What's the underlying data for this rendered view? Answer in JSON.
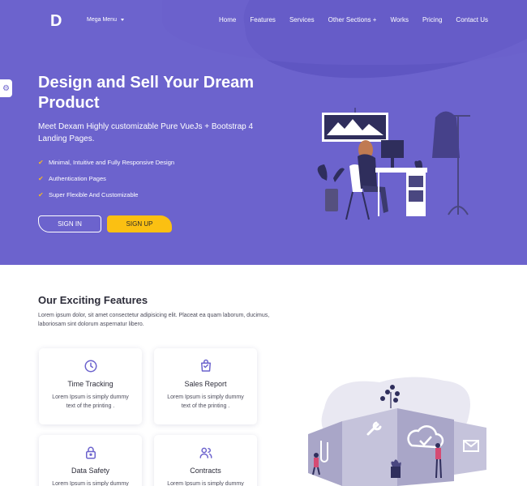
{
  "nav": {
    "logo": "D",
    "mega_menu": "Mega Menu",
    "items": [
      "Home",
      "Features",
      "Services",
      "Other Sections +",
      "Works",
      "Pricing",
      "Contact Us"
    ]
  },
  "hero": {
    "title": "Design and Sell Your Dream Product",
    "subtitle": "Meet Dexam Highly customizable Pure VueJs + Bootstrap 4 Landing Pages.",
    "checklist": [
      "Minimal, Intuitive and Fully Responsive Design",
      "Authentication Pages",
      "Super Flexible And Customizable"
    ],
    "sign_in": "SIGN IN",
    "sign_up": "SIGN UP"
  },
  "features": {
    "title": "Our Exciting Features",
    "description": "Lorem ipsum dolor, sit amet consectetur adipisicing elit. Placeat ea quam laborum, ducimus, laboriosam sint dolorum aspernatur libero.",
    "cards": [
      {
        "icon": "clock-icon",
        "title": "Time Tracking",
        "text": "Lorem Ipsum is simply dummy text of the printing ."
      },
      {
        "icon": "shopping-bag-icon",
        "title": "Sales Report",
        "text": "Lorem Ipsum is simply dummy text of the printing ."
      },
      {
        "icon": "lock-icon",
        "title": "Data Safety",
        "text": "Lorem Ipsum is simply dummy"
      },
      {
        "icon": "users-icon",
        "title": "Contracts",
        "text": "Lorem Ipsum is simply dummy"
      }
    ]
  },
  "colors": {
    "hero_bg": "#6c63cd",
    "accent": "#fbc012",
    "icon": "#6c63cd"
  }
}
